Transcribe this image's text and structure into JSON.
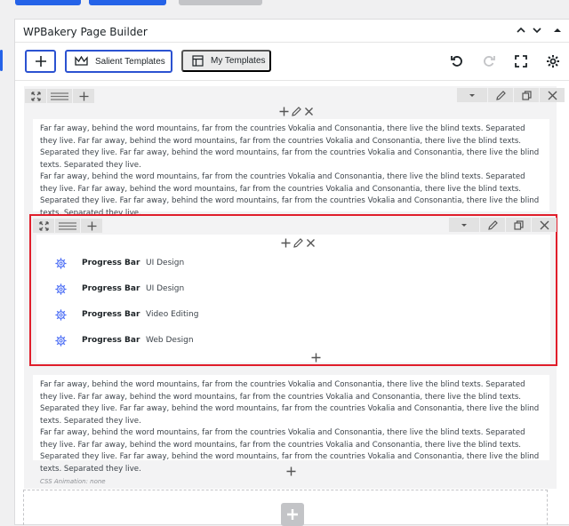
{
  "panel": {
    "title": "WPBakery Page Builder"
  },
  "toolbar": {
    "add_label": "Add Element",
    "salient_templates_label": "Salient Templates",
    "my_templates_label": "My Templates"
  },
  "text_block": {
    "paragraph_1": "Far far away, behind the word mountains, far from the countries Vokalia and Consonantia, there live the blind texts. Separated they live. Far far away, behind the word mountains, far from the countries Vokalia and Consonantia, there live the blind texts. Separated they live. Far far away, behind the word mountains, far from the countries Vokalia and Consonantia, there live the blind texts. Separated they live.",
    "paragraph_2": "Far far away, behind the word mountains, far from the countries Vokalia and Consonantia, there live the blind texts. Separated they live. Far far away, behind the word mountains, far from the countries Vokalia and Consonantia, there live the blind texts. Separated they live. Far far away, behind the word mountains, far from the countries Vokalia and Consonantia, there live the blind texts. Separated they live.",
    "css_animation": "CSS Animation: none"
  },
  "progress_bars": [
    {
      "name": "Progress Bar",
      "label": "UI Design"
    },
    {
      "name": "Progress Bar",
      "label": "UI Design"
    },
    {
      "name": "Progress Bar",
      "label": "Video Editing"
    },
    {
      "name": "Progress Bar",
      "label": "Web Design"
    }
  ],
  "colors": {
    "accent": "#2b52d1",
    "selection_border": "#e01e2b",
    "progress_icon": "#4c6ef5"
  }
}
